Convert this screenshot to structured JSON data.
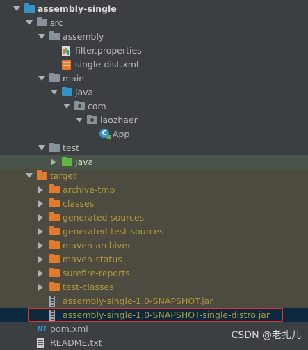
{
  "tree": [
    {
      "id": "assembly-single",
      "label": "assembly-single",
      "depth": 0,
      "arrow": "open",
      "icon": "folder",
      "iconColor": "blue",
      "style": "bold"
    },
    {
      "id": "src",
      "label": "src",
      "depth": 1,
      "arrow": "open",
      "icon": "folder",
      "iconColor": "gray"
    },
    {
      "id": "assembly",
      "label": "assembly",
      "depth": 2,
      "arrow": "open",
      "icon": "folder",
      "iconColor": "gray"
    },
    {
      "id": "filter-properties",
      "label": "filter.properties",
      "depth": 3,
      "arrow": "none",
      "icon": "properties"
    },
    {
      "id": "single-dist-xml",
      "label": "single-dist.xml",
      "depth": 3,
      "arrow": "none",
      "icon": "xml"
    },
    {
      "id": "main",
      "label": "main",
      "depth": 2,
      "arrow": "open",
      "icon": "folder",
      "iconColor": "gray"
    },
    {
      "id": "java-main",
      "label": "java",
      "depth": 3,
      "arrow": "open",
      "icon": "folder",
      "iconColor": "blue"
    },
    {
      "id": "com",
      "label": "com",
      "depth": 4,
      "arrow": "open",
      "icon": "package"
    },
    {
      "id": "laozhaer",
      "label": "laozhaer",
      "depth": 5,
      "arrow": "open",
      "icon": "package"
    },
    {
      "id": "app",
      "label": "App",
      "depth": 6,
      "arrow": "none",
      "icon": "class"
    },
    {
      "id": "test",
      "label": "test",
      "depth": 2,
      "arrow": "open",
      "icon": "folder",
      "iconColor": "gray"
    },
    {
      "id": "java-test",
      "label": "java",
      "depth": 3,
      "arrow": "closed",
      "icon": "folder",
      "iconColor": "green",
      "bg": "test"
    },
    {
      "id": "target",
      "label": "target",
      "depth": 1,
      "arrow": "open",
      "icon": "folder",
      "iconColor": "orange",
      "style": "excluded",
      "bg": "target"
    },
    {
      "id": "archive-tmp",
      "label": "archive-tmp",
      "depth": 2,
      "arrow": "closed",
      "icon": "folder",
      "iconColor": "orange",
      "style": "excluded",
      "bg": "target"
    },
    {
      "id": "classes",
      "label": "classes",
      "depth": 2,
      "arrow": "closed",
      "icon": "folder",
      "iconColor": "orange",
      "style": "excluded",
      "bg": "target"
    },
    {
      "id": "generated-sources",
      "label": "generated-sources",
      "depth": 2,
      "arrow": "closed",
      "icon": "folder",
      "iconColor": "orange",
      "style": "excluded",
      "bg": "target"
    },
    {
      "id": "generated-test-sources",
      "label": "generated-test-sources",
      "depth": 2,
      "arrow": "closed",
      "icon": "folder",
      "iconColor": "orange",
      "style": "excluded",
      "bg": "target"
    },
    {
      "id": "maven-archiver",
      "label": "maven-archiver",
      "depth": 2,
      "arrow": "closed",
      "icon": "folder",
      "iconColor": "orange",
      "style": "excluded",
      "bg": "target"
    },
    {
      "id": "maven-status",
      "label": "maven-status",
      "depth": 2,
      "arrow": "closed",
      "icon": "folder",
      "iconColor": "orange",
      "style": "excluded",
      "bg": "target"
    },
    {
      "id": "surefire-reports",
      "label": "surefire-reports",
      "depth": 2,
      "arrow": "closed",
      "icon": "folder",
      "iconColor": "orange",
      "style": "excluded",
      "bg": "target"
    },
    {
      "id": "test-classes",
      "label": "test-classes",
      "depth": 2,
      "arrow": "closed",
      "icon": "folder",
      "iconColor": "orange",
      "style": "excluded",
      "bg": "target"
    },
    {
      "id": "jar-snapshot",
      "label": "assembly-single-1.0-SNAPSHOT.jar",
      "depth": 2,
      "arrow": "none",
      "icon": "jar",
      "style": "excluded",
      "bg": "target"
    },
    {
      "id": "jar-distro",
      "label": "assembly-single-1.0-SNAPSHOT-single-distro.jar",
      "depth": 2,
      "arrow": "none",
      "icon": "jar",
      "style": "excluded",
      "bg": "selected",
      "highlighted": true
    },
    {
      "id": "pom-xml",
      "label": "pom.xml",
      "depth": 1,
      "arrow": "none",
      "icon": "maven"
    },
    {
      "id": "readme",
      "label": "README.txt",
      "depth": 1,
      "arrow": "none",
      "icon": "text"
    }
  ],
  "colors": {
    "background": "#3c3f41",
    "text": "#bbbbbb",
    "excluded_text": "#b09a3c",
    "selection": "#0d293e",
    "highlight_border": "#e1332f"
  },
  "watermark": "CSDN @老扎儿"
}
